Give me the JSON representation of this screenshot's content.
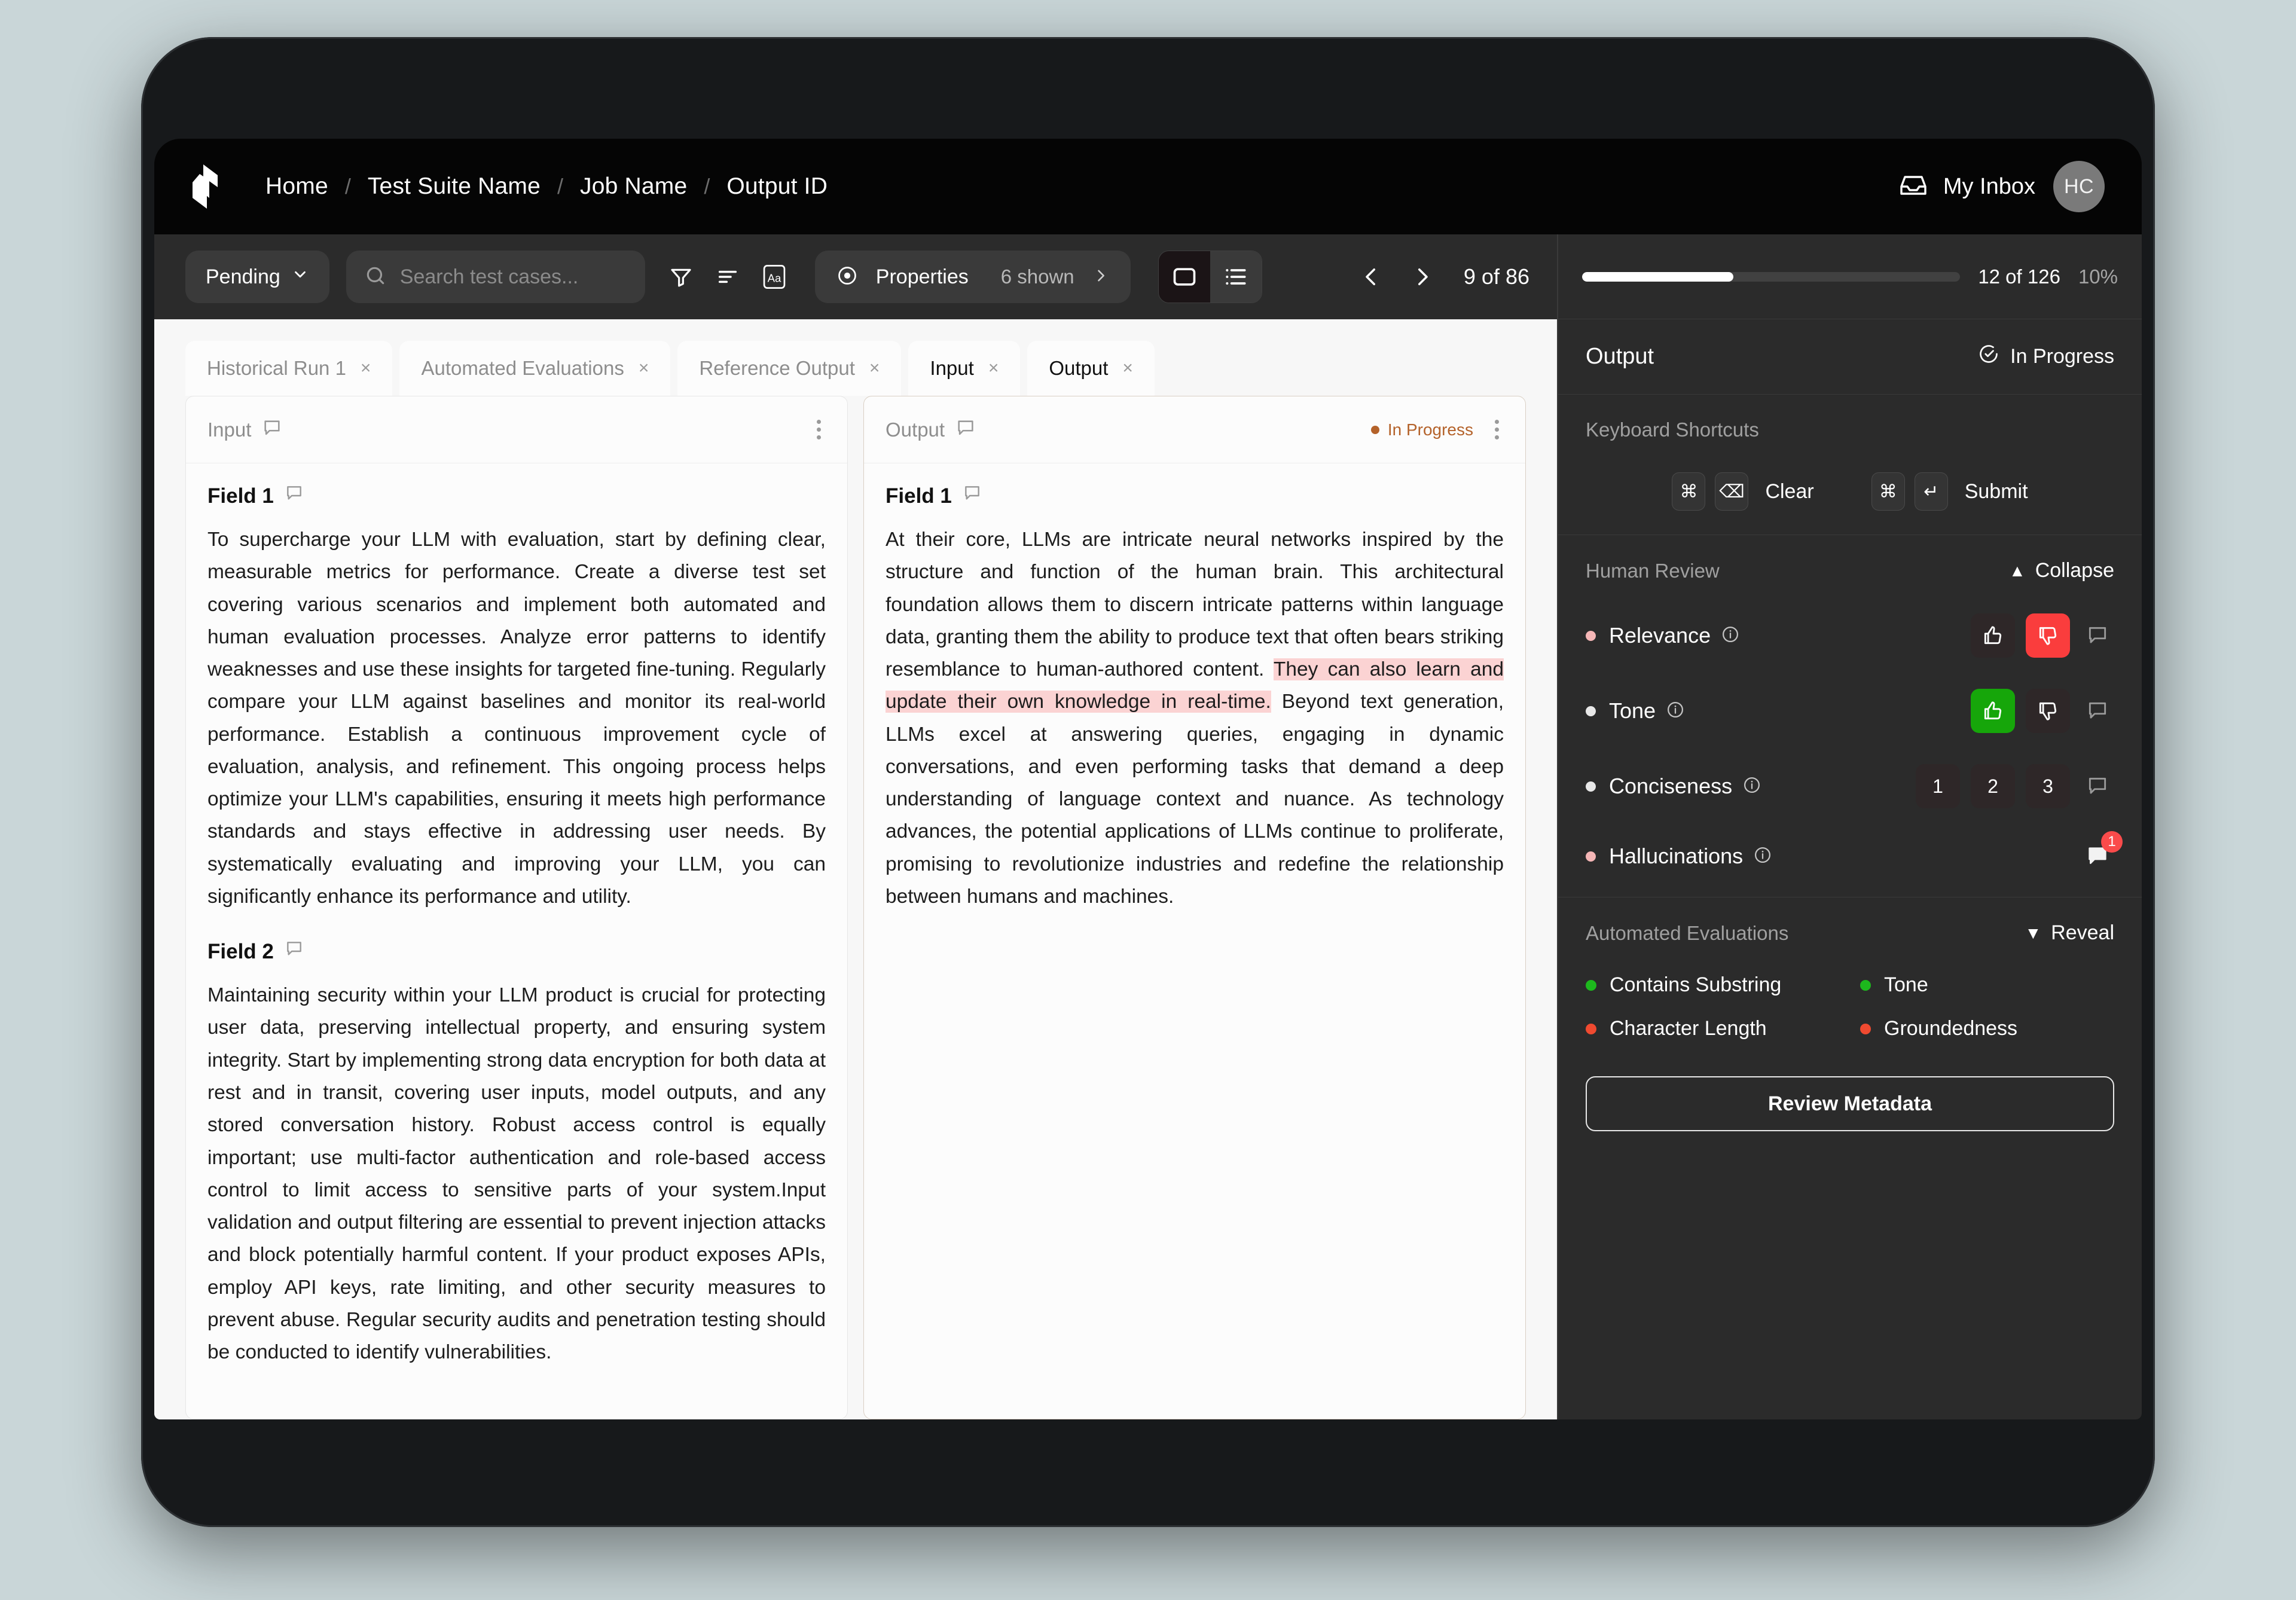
{
  "header": {
    "logo_icon": "cube-logo-icon",
    "breadcrumbs": [
      "Home",
      "Test Suite Name",
      "Job Name",
      "Output ID"
    ],
    "separator": "/",
    "inbox_label": "My Inbox",
    "inbox_icon": "inbox-icon",
    "avatar_initials": "HC"
  },
  "toolbar": {
    "status_filter": "Pending",
    "chevron": "⌄",
    "search_placeholder": "Search test cases...",
    "search_value": "",
    "filter_icon": "funnel-icon",
    "sort_icon": "sort-icon",
    "text_icon": "text-format-icon",
    "properties_label": "Properties",
    "properties_count": "6 shown",
    "properties_chevron": "›",
    "view_card_icon": "card-view-icon",
    "view_list_icon": "list-view-icon",
    "prev_icon": "chevron-left-icon",
    "next_icon": "chevron-right-icon",
    "pager_text": "9 of 86"
  },
  "tabs": [
    {
      "label": "Historical Run 1",
      "active": false
    },
    {
      "label": "Automated Evaluations",
      "active": false
    },
    {
      "label": "Reference Output",
      "active": false
    },
    {
      "label": "Input",
      "active": true
    },
    {
      "label": "Output",
      "active": true
    }
  ],
  "tab_close_glyph": "×",
  "input_panel": {
    "title": "Input",
    "comment_icon": "comment-bubble-icon",
    "menu_icon": "kebab-menu-icon",
    "fields": [
      {
        "label": "Field 1",
        "text": "To supercharge your LLM with evaluation, start by defining clear, measurable metrics for performance. Create a diverse test set covering various scenarios and implement both automated and human evaluation processes. Analyze error patterns to identify weaknesses and use these insights for targeted fine-tuning. Regularly compare your LLM against baselines and monitor its real-world performance. Establish a continuous improvement cycle of evaluation, analysis, and refinement. This ongoing process helps optimize your LLM's capabilities, ensuring it meets high performance standards and stays effective in addressing user needs. By systematically evaluating and improving your LLM, you can significantly enhance its performance and utility."
      },
      {
        "label": "Field 2",
        "text": "Maintaining security within your LLM product is crucial for protecting user data, preserving intellectual property, and ensuring system integrity. Start by implementing strong data encryption for both data at rest and in transit, covering user inputs, model outputs, and any stored conversation history. Robust access control is equally important; use multi-factor authentication and role-based access control to limit access to sensitive parts of your system.Input validation and output filtering are essential to prevent injection attacks and block potentially harmful content. If your product exposes APIs, employ API keys, rate limiting, and other security measures to prevent abuse. Regular security audits and penetration testing should be conducted to identify vulnerabilities."
      }
    ]
  },
  "output_panel": {
    "title": "Output",
    "comment_icon": "comment-bubble-icon",
    "menu_icon": "kebab-menu-icon",
    "status": "In Progress",
    "field_label": "Field 1",
    "text_before": "At their core, LLMs are intricate neural networks inspired by the structure and function of the human brain. This architectural foundation allows them to discern intricate patterns within language data, granting them the ability to produce text that often bears striking resemblance to human-authored content. ",
    "text_highlight": "They can also learn and update their own knowledge in real-time.",
    "text_after": " Beyond text generation, LLMs excel at answering queries, engaging in dynamic conversations, and even performing tasks that demand a deep understanding of language context and nuance. As technology advances, the potential applications of LLMs continue to proliferate, promising to revolutionize industries and redefine the relationship between humans and machines.",
    "highlight_color": "#fbd3d3"
  },
  "sidebar": {
    "progress": {
      "percent_fill": 40,
      "count_text": "12 of 126",
      "percent_text": "10%"
    },
    "output_header": {
      "title": "Output",
      "status": "In Progress",
      "status_icon": "clock-check-icon"
    },
    "shortcuts": {
      "title": "Keyboard Shortcuts",
      "items": [
        {
          "keys": [
            "⌘",
            "⌫"
          ],
          "label": "Clear",
          "key_icons": [
            "command-key-icon",
            "delete-key-icon"
          ]
        },
        {
          "keys": [
            "⌘",
            "↵"
          ],
          "label": "Submit",
          "key_icons": [
            "command-key-icon",
            "enter-key-icon"
          ]
        }
      ]
    },
    "human_review": {
      "title": "Human Review",
      "collapse_label": "Collapse",
      "collapse_caret": "▲",
      "rows": [
        {
          "label": "Relevance",
          "dot_color": "#f5b6b6",
          "control": "thumbs",
          "thumb_up": false,
          "thumb_down": true,
          "info_icon": "info-icon",
          "comment_icon": "comment-bubble-icon",
          "comment_count": 0
        },
        {
          "label": "Tone",
          "dot_color": "#e8e8e8",
          "control": "thumbs",
          "thumb_up": true,
          "thumb_down": false,
          "info_icon": "info-icon",
          "comment_icon": "comment-bubble-icon",
          "comment_count": 0
        },
        {
          "label": "Conciseness",
          "dot_color": "#e8e8e8",
          "control": "scale",
          "scale": [
            "1",
            "2",
            "3"
          ],
          "selected": null,
          "info_icon": "info-icon",
          "comment_icon": "comment-bubble-icon",
          "comment_count": 0
        },
        {
          "label": "Hallucinations",
          "dot_color": "#f5b6b6",
          "control": "comment-only",
          "info_icon": "info-icon",
          "comment_icon": "comment-bubble-filled-icon",
          "comment_count": 1
        }
      ]
    },
    "automated_evaluations": {
      "title": "Automated Evaluations",
      "reveal_label": "Reveal",
      "reveal_caret": "▼",
      "items": [
        {
          "label": "Contains Substring",
          "dot_color": "#1db81d"
        },
        {
          "label": "Tone",
          "dot_color": "#1db81d"
        },
        {
          "label": "Character Length",
          "dot_color": "#f04a30"
        },
        {
          "label": "Groundedness",
          "dot_color": "#f04a30"
        }
      ],
      "metadata_button": "Review Metadata"
    }
  },
  "colors": {
    "accent_green": "#16a60a",
    "accent_red": "#fa3d3d",
    "in_progress": "#b4622a",
    "panel_bg": "#fcfcfc",
    "sidebar_bg": "#2b2b2b"
  }
}
